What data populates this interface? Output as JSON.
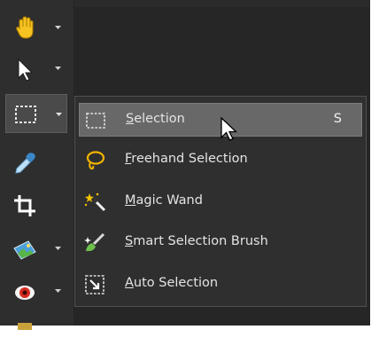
{
  "toolbar": {
    "tools": [
      {
        "name": "pan-tool",
        "icon": "hand-icon",
        "has_dropdown": true
      },
      {
        "name": "pick-tool",
        "icon": "arrow-pointer-icon",
        "has_dropdown": true
      },
      {
        "name": "selection-tool",
        "icon": "marquee-selection-icon",
        "has_dropdown": true,
        "active": true
      },
      {
        "name": "dropper-tool",
        "icon": "eyedropper-icon",
        "has_dropdown": false
      },
      {
        "name": "crop-tool",
        "icon": "crop-icon",
        "has_dropdown": false
      },
      {
        "name": "straighten-tool",
        "icon": "photo-adjust-icon",
        "has_dropdown": true
      },
      {
        "name": "red-eye-tool",
        "icon": "eye-icon",
        "has_dropdown": true
      }
    ]
  },
  "menu": {
    "items": [
      {
        "label": "Selection",
        "shortcut": "S",
        "icon": "marquee-selection-icon",
        "hovered": true
      },
      {
        "label": "Freehand Selection",
        "shortcut": "",
        "icon": "lasso-icon"
      },
      {
        "label": "Magic Wand",
        "shortcut": "",
        "icon": "magic-wand-icon"
      },
      {
        "label": "Smart Selection Brush",
        "shortcut": "",
        "icon": "smart-brush-icon"
      },
      {
        "label": "Auto Selection",
        "shortcut": "",
        "icon": "auto-selection-icon"
      }
    ]
  },
  "colors": {
    "background": "#2b2b2b",
    "menu_background": "#2f2f2f",
    "hover": "#686868",
    "text": "#e4e4e4",
    "lasso_yellow": "#f2b400"
  }
}
